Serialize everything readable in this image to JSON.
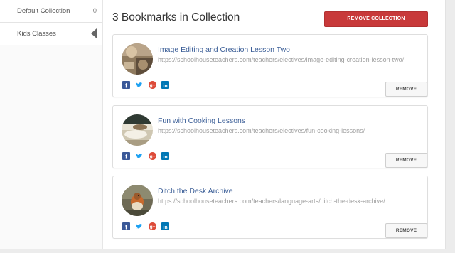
{
  "sidebar": {
    "items": [
      {
        "label": "Default Collection",
        "count": "0"
      },
      {
        "label": "Kids Classes"
      }
    ]
  },
  "main": {
    "heading": "3 Bookmarks in Collection",
    "remove_collection_label": "REMOVE COLLECTION"
  },
  "bookmarks": [
    {
      "title": "Image Editing and Creation Lesson Two",
      "url": "https://schoolhouseteachers.com/teachers/electives/image-editing-creation-lesson-two/",
      "remove_label": "REMOVE",
      "thumb_icon": "painting-photo-thumbnail"
    },
    {
      "title": "Fun with Cooking Lessons",
      "url": "https://schoolhouseteachers.com/teachers/electives/fun-cooking-lessons/",
      "remove_label": "REMOVE",
      "thumb_icon": "cooking-photo-thumbnail"
    },
    {
      "title": "Ditch the Desk Archive",
      "url": "https://schoolhouseteachers.com/teachers/language-arts/ditch-the-desk-archive/",
      "remove_label": "REMOVE",
      "thumb_icon": "bird-photo-thumbnail"
    }
  ],
  "social_icons": [
    "facebook-icon",
    "twitter-icon",
    "google-plus-icon",
    "linkedin-icon"
  ],
  "colors": {
    "accent_red": "#c8393a",
    "link_blue": "#3b5e97",
    "facebook": "#3b5998",
    "twitter": "#1da1f2",
    "google_plus": "#dd4b39",
    "linkedin": "#0077b5"
  }
}
